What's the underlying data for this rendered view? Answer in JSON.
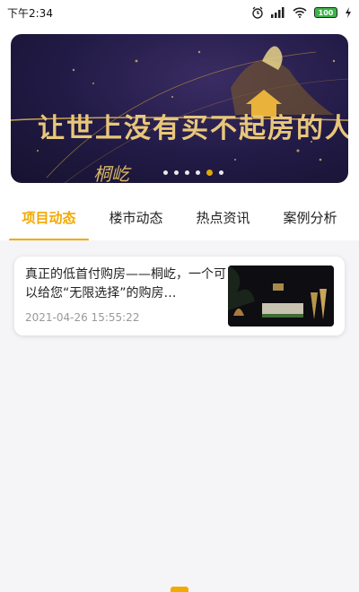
{
  "status_bar": {
    "time": "下午2:34",
    "battery": "100"
  },
  "banner": {
    "headline": "让世上没有买不起房的人",
    "signature": "桐屹",
    "dot_count": 6,
    "active_dot": 4
  },
  "tabs": [
    {
      "label": "项目动态",
      "active": true
    },
    {
      "label": "楼市动态",
      "active": false
    },
    {
      "label": "热点资讯",
      "active": false
    },
    {
      "label": "案例分析",
      "active": false
    }
  ],
  "news": [
    {
      "title": "真正的低首付购房——桐屹，一个可以给您“无限选择”的购房…",
      "time": "2021-04-26 15:55:22"
    }
  ],
  "colors": {
    "accent": "#f2a900",
    "banner_bg": "#211a45",
    "banner_gold": "#e9c77a"
  }
}
